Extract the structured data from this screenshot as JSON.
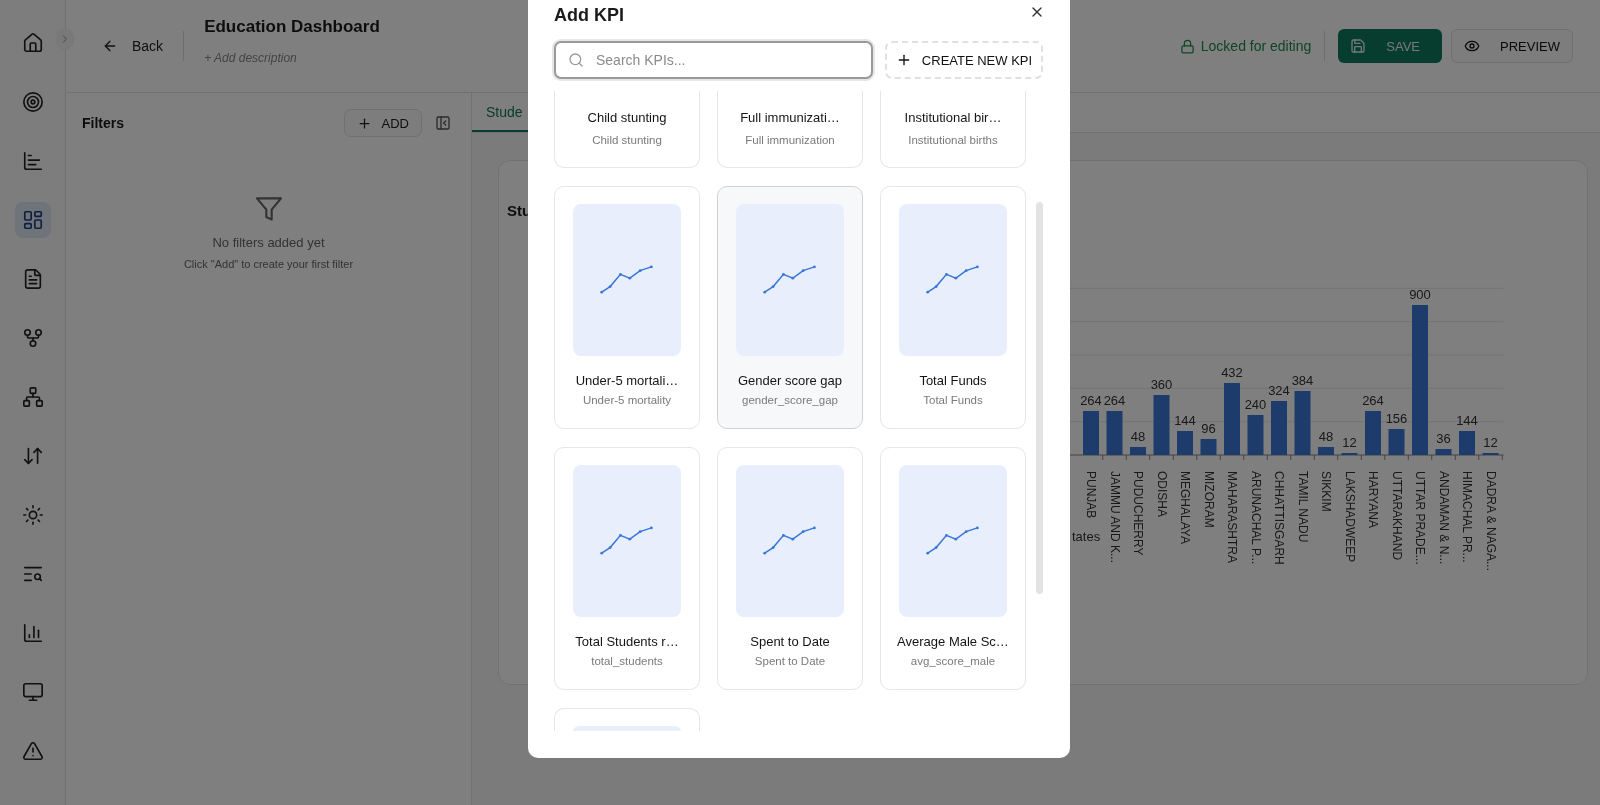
{
  "nav_rail": {
    "items": [
      {
        "selected": false
      },
      {
        "selected": false
      },
      {
        "selected": false
      },
      {
        "selected": true
      },
      {
        "selected": false
      },
      {
        "selected": false
      },
      {
        "selected": false
      },
      {
        "selected": false
      },
      {
        "selected": false
      },
      {
        "selected": false
      },
      {
        "selected": false
      },
      {
        "selected": false
      },
      {
        "selected": false
      }
    ]
  },
  "header": {
    "back": "Back",
    "title": "Education Dashboard",
    "add_description": "+ Add description",
    "lock_status": "Locked for editing",
    "save": "SAVE",
    "preview": "PREVIEW"
  },
  "filters": {
    "title": "Filters",
    "add": "ADD",
    "empty_title": "No filters added yet",
    "empty_hint": "Click \"Add\" to create your first filter"
  },
  "tabs": [
    {
      "label": "Stude",
      "selected": true
    }
  ],
  "chart_card": {
    "title": "Stu",
    "chart_data": {
      "type": "bar",
      "xlabel": "tates",
      "categories": [
        "PUNJAB",
        "JAMMU AND K...",
        "PUDUCHERRY",
        "ODISHA",
        "MEGHALAYA",
        "MIZORAM",
        "MAHARASHTRA",
        "ARUNACHAL P...",
        "CHHATTISGARH",
        "TAMIL NADU",
        "SIKKIM",
        "LAKSHADWEEP",
        "HARYANA",
        "UTTARAKHAND",
        "UTTAR PRADE...",
        "ANDAMAN & N...",
        "HIMACHAL PR...",
        "DADRA & NAGA..."
      ],
      "values": [
        264,
        264,
        48,
        360,
        144,
        96,
        432,
        240,
        324,
        384,
        48,
        12,
        264,
        156,
        900,
        36,
        144,
        12
      ],
      "data_labels": true
    }
  },
  "modal": {
    "title": "Add KPI",
    "search": {
      "placeholder": "Search KPIs..."
    },
    "create": "CREATE NEW KPI",
    "kpis": [
      {
        "kind": "cut_top",
        "title": "Child stunting",
        "subtitle": "Child stunting",
        "selected": false
      },
      {
        "kind": "cut_top",
        "title": "Full immunizati…",
        "subtitle": "Full immunization",
        "selected": false
      },
      {
        "kind": "cut_top",
        "title": "Institutional bir…",
        "subtitle": "Institutional births",
        "selected": false
      },
      {
        "kind": "full",
        "title": "Under-5 mortali…",
        "subtitle": "Under-5 mortality",
        "selected": false
      },
      {
        "kind": "full",
        "title": "Gender score gap",
        "subtitle": "gender_score_gap",
        "selected": true
      },
      {
        "kind": "full",
        "title": "Total Funds",
        "subtitle": "Total Funds",
        "selected": false
      },
      {
        "kind": "full",
        "title": "Total Students r…",
        "subtitle": "total_students",
        "selected": false
      },
      {
        "kind": "full",
        "title": "Spent to Date",
        "subtitle": "Spent to Date",
        "selected": false
      },
      {
        "kind": "full",
        "title": "Average Male Sc…",
        "subtitle": "avg_score_male",
        "selected": false
      },
      {
        "kind": "cut_bottom",
        "selected": false
      }
    ]
  }
}
